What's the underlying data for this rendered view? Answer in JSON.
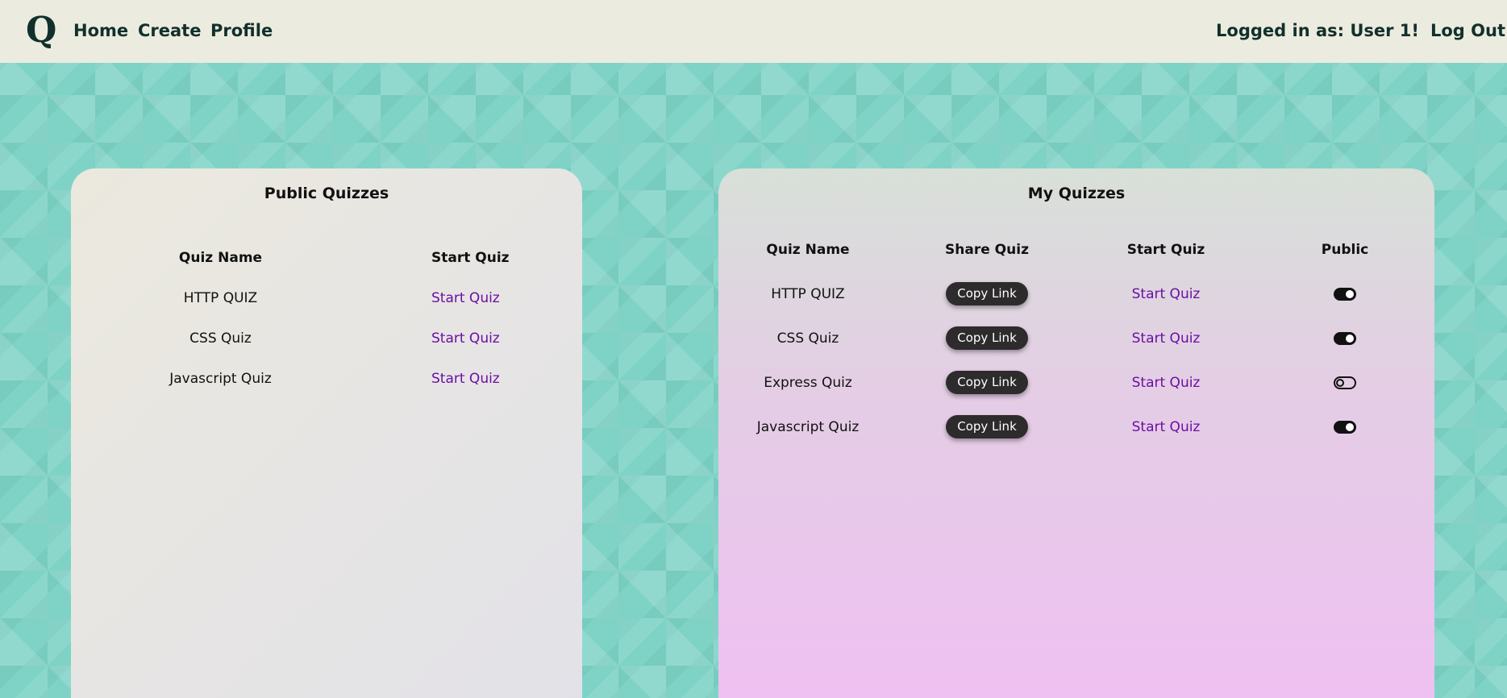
{
  "header": {
    "logo": "Q",
    "nav": {
      "home": "Home",
      "create": "Create",
      "profile": "Profile"
    },
    "logged_in_text": "Logged in as: User 1!",
    "logout": "Log Out"
  },
  "public_quizzes": {
    "title": "Public Quizzes",
    "columns": [
      "Quiz Name",
      "Start Quiz"
    ],
    "rows": [
      {
        "name": "HTTP QUIZ",
        "start": "Start Quiz"
      },
      {
        "name": "CSS Quiz",
        "start": "Start Quiz"
      },
      {
        "name": "Javascript Quiz",
        "start": "Start Quiz"
      }
    ]
  },
  "my_quizzes": {
    "title": "My Quizzes",
    "columns": [
      "Quiz Name",
      "Share Quiz",
      "Start Quiz",
      "Public"
    ],
    "rows": [
      {
        "name": "HTTP QUIZ",
        "share": "Copy Link",
        "start": "Start Quiz",
        "public": true
      },
      {
        "name": "CSS Quiz",
        "share": "Copy Link",
        "start": "Start Quiz",
        "public": true
      },
      {
        "name": "Express Quiz",
        "share": "Copy Link",
        "start": "Start Quiz",
        "public": false
      },
      {
        "name": "Javascript Quiz",
        "share": "Copy Link",
        "start": "Start Quiz",
        "public": true
      }
    ]
  },
  "colors": {
    "background_teal": "#7fd3c6",
    "header_bg": "#ecebdf",
    "nav_text": "#11302b",
    "link_purple": "#6b0fa4",
    "button_dark": "#2d2b2b"
  }
}
